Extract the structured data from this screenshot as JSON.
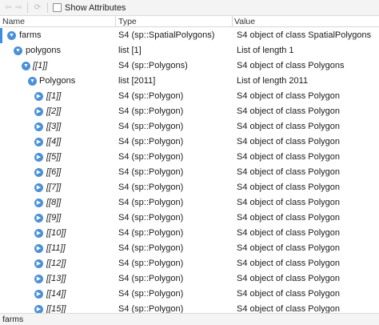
{
  "toolbar": {
    "show_attributes_label": "Show Attributes"
  },
  "columns": {
    "name": "Name",
    "type": "Type",
    "value": "Value"
  },
  "rows": [
    {
      "name": "farms",
      "type": "S4 (sp::SpatialPolygons)",
      "value": "S4 object of class SpatialPolygons",
      "expanded": true
    },
    {
      "name": "polygons",
      "type": "list [1]",
      "value": "List of length 1",
      "expanded": true
    },
    {
      "name": "[[1]]",
      "type": "S4 (sp::Polygons)",
      "value": "S4 object of class Polygons",
      "expanded": true
    },
    {
      "name": "Polygons",
      "type": "list [2011]",
      "value": "List of length 2011",
      "expanded": true
    },
    {
      "name": "[[1]]",
      "type": "S4 (sp::Polygon)",
      "value": "S4 object of class Polygon",
      "expanded": false
    },
    {
      "name": "[[2]]",
      "type": "S4 (sp::Polygon)",
      "value": "S4 object of class Polygon",
      "expanded": false
    },
    {
      "name": "[[3]]",
      "type": "S4 (sp::Polygon)",
      "value": "S4 object of class Polygon",
      "expanded": false
    },
    {
      "name": "[[4]]",
      "type": "S4 (sp::Polygon)",
      "value": "S4 object of class Polygon",
      "expanded": false
    },
    {
      "name": "[[5]]",
      "type": "S4 (sp::Polygon)",
      "value": "S4 object of class Polygon",
      "expanded": false
    },
    {
      "name": "[[6]]",
      "type": "S4 (sp::Polygon)",
      "value": "S4 object of class Polygon",
      "expanded": false
    },
    {
      "name": "[[7]]",
      "type": "S4 (sp::Polygon)",
      "value": "S4 object of class Polygon",
      "expanded": false
    },
    {
      "name": "[[8]]",
      "type": "S4 (sp::Polygon)",
      "value": "S4 object of class Polygon",
      "expanded": false
    },
    {
      "name": "[[9]]",
      "type": "S4 (sp::Polygon)",
      "value": "S4 object of class Polygon",
      "expanded": false
    },
    {
      "name": "[[10]]",
      "type": "S4 (sp::Polygon)",
      "value": "S4 object of class Polygon",
      "expanded": false
    },
    {
      "name": "[[11]]",
      "type": "S4 (sp::Polygon)",
      "value": "S4 object of class Polygon",
      "expanded": false
    },
    {
      "name": "[[12]]",
      "type": "S4 (sp::Polygon)",
      "value": "S4 object of class Polygon",
      "expanded": false
    },
    {
      "name": "[[13]]",
      "type": "S4 (sp::Polygon)",
      "value": "S4 object of class Polygon",
      "expanded": false
    },
    {
      "name": "[[14]]",
      "type": "S4 (sp::Polygon)",
      "value": "S4 object of class Polygon",
      "expanded": false
    },
    {
      "name": "[[15]]",
      "type": "S4 (sp::Polygon)",
      "value": "S4 object of class Polygon",
      "expanded": false
    }
  ],
  "status": {
    "text": "farms"
  }
}
